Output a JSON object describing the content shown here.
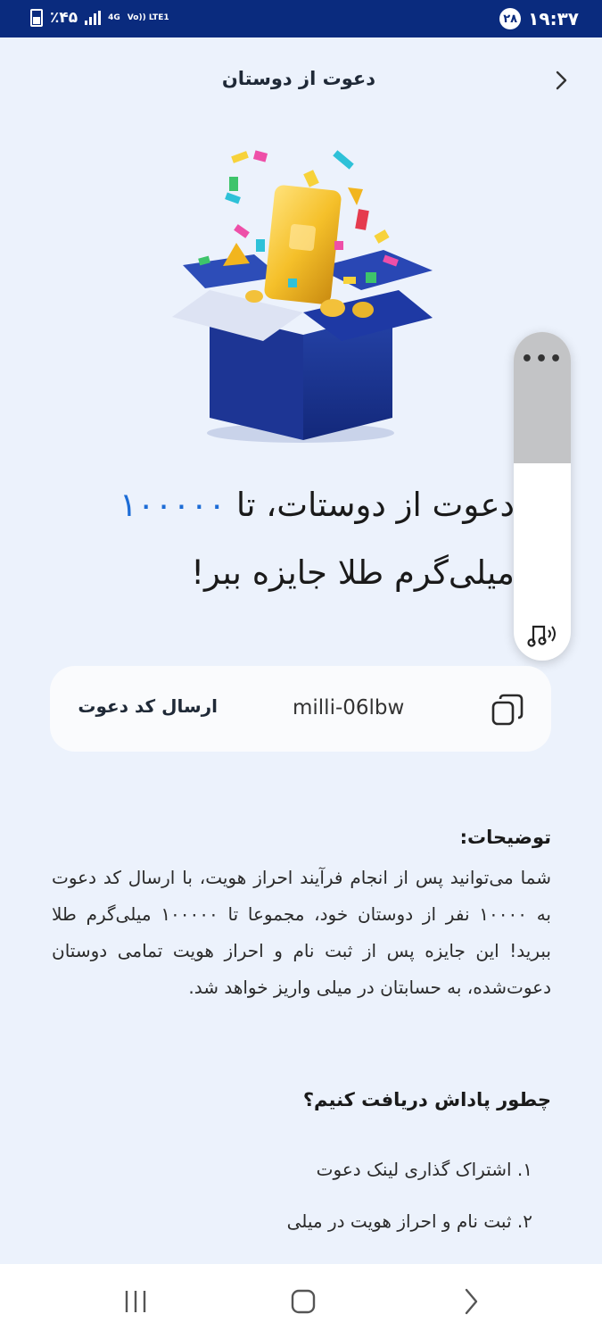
{
  "status_bar": {
    "time": "۱۹:۳۷",
    "notification_count": "۲۸",
    "battery": "٪۴۵",
    "network_type": "4G",
    "network_label": "Vo)) LTE1"
  },
  "header": {
    "title": "دعوت از دوستان"
  },
  "headline": {
    "part1": "دعوت از دوستات، تا ",
    "amount": "۱۰۰۰۰۰",
    "part2": " میلی‌گرم طلا جایزه ببر!"
  },
  "invite": {
    "send_label": "ارسال کد دعوت",
    "code": "milli-06lbw"
  },
  "description": {
    "title": "توضیحات:",
    "body": "شما می‌توانید پس از انجام فرآیند احراز هویت، با ارسال کد دعوت به ۱۰۰۰۰ نفر از دوستان خود، مجموعا تا ۱۰۰۰۰۰ میلی‌گرم طلا ببرید! این جایزه پس از ثبت نام و احراز هویت تمامی دوستان دعوت‌شده، به حسابتان در میلی واریز خواهد شد."
  },
  "how_to": {
    "title": "چطور پاداش دریافت کنیم؟",
    "steps": [
      "۱. اشتراک گذاری لینک دعوت",
      "۲. ثبت نام و احراز هویت در میلی"
    ]
  },
  "colors": {
    "accent": "#1C6CD6",
    "status_bar": "#0A2B7E",
    "background": "#ECF2FC"
  },
  "icons": {
    "back": "chevron-right-icon",
    "copy": "copy-icon",
    "widget_menu": "more-dots-icon",
    "widget_audio": "music-note-sound-icon",
    "nav_recents": "recents-icon",
    "nav_home": "home-icon",
    "nav_back": "back-arrow-icon"
  }
}
